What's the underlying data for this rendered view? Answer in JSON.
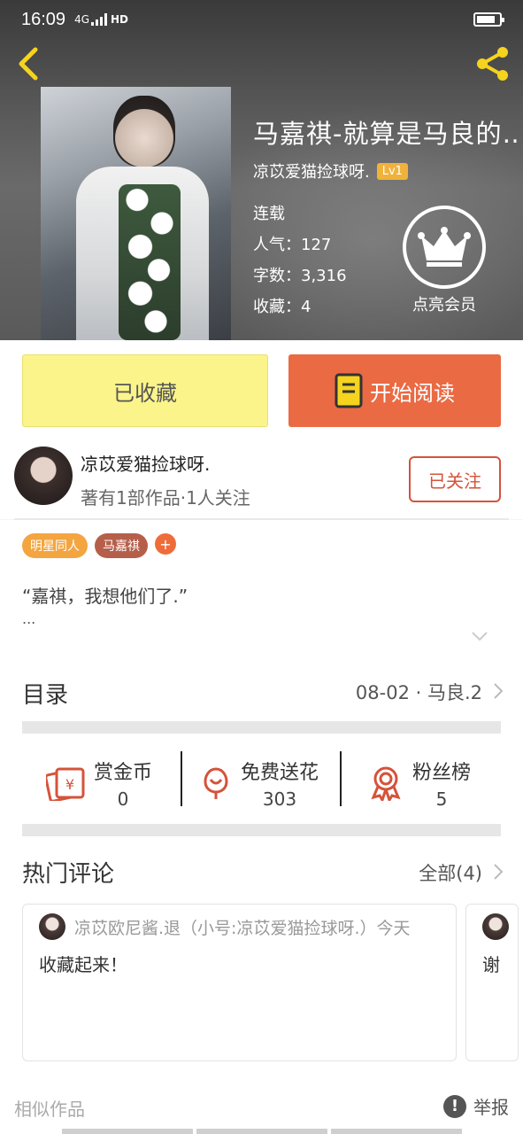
{
  "status_bar": {
    "time": "16:09",
    "network": "4G",
    "hd": "HD"
  },
  "book": {
    "title": "马嘉祺-就算是马良的…",
    "author": "凉苡爱猫捡球呀.",
    "level": "Lv1",
    "status": "连载",
    "popularity": "人气：127",
    "word_count": "字数：3,316",
    "favorites": "收藏：4"
  },
  "vip": {
    "label": "点亮会员"
  },
  "actions": {
    "favorited_label": "已收藏",
    "read_label": "开始阅读"
  },
  "author_card": {
    "name": "凉苡爱猫捡球呀.",
    "summary": "著有1部作品·1人关注",
    "follow_label": "已关注"
  },
  "tags": [
    {
      "label": "明星同人"
    },
    {
      "label": "马嘉祺"
    },
    {
      "label": "+"
    }
  ],
  "intro": {
    "quote": "“嘉祺，我想他们了.”",
    "ellipsis": "..."
  },
  "toc": {
    "label": "目录",
    "latest": "08-02 · 马良.2"
  },
  "stats": [
    {
      "label": "赏金币",
      "value": "0"
    },
    {
      "label": "免费送花",
      "value": "303"
    },
    {
      "label": "粉丝榜",
      "value": "5"
    }
  ],
  "comments": {
    "header": "热门评论",
    "all_label": "全部(4)",
    "items": [
      {
        "user": "凉苡欧尼酱.退（小号:凉苡爱猫捡球呀.）今天",
        "text": "收藏起来！"
      },
      {
        "user": "",
        "text": "谢"
      }
    ]
  },
  "footer": {
    "similar": "相似作品",
    "report": "举报"
  },
  "colors": {
    "accent_orange": "#ea6a43",
    "favorite_yellow": "#fbf48b",
    "icon_red": "#d5533a",
    "hero_icon_yellow": "#f5d31f"
  }
}
